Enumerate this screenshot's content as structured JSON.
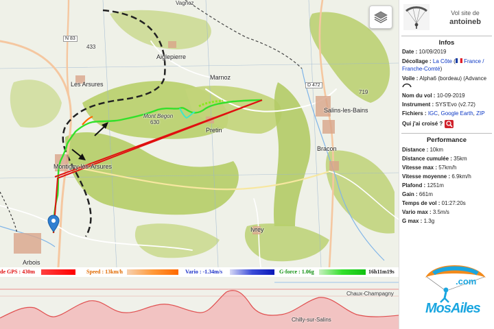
{
  "map": {
    "labels": {
      "aiglepierre": "Aiglepierre",
      "les_arsures": "Les Arsures",
      "marnoz": "Marnoz",
      "salins": "Salins-les-Bains",
      "mont_begon": "Mont Begon",
      "begon_alt": "630",
      "pretin": "Pretin",
      "bracon": "Bracon",
      "montigny": "Montigny-lès-Arsures",
      "ivrey": "Ivrey",
      "arbois": "Arbois",
      "chaux": "Chaux-Champagny",
      "chilly": "Chilly-sur-Salins",
      "n83": "N 83",
      "d472": "D 472",
      "spot_433": "433",
      "spot_719": "719",
      "vagnoz": "Vagnoz"
    },
    "layers_icon": "layers-icon",
    "pin_icon": "map-pin-icon"
  },
  "indicators": {
    "gps": "de GPS : 430m",
    "speed": "Speed : 13km/h",
    "vario": "Vario : -1.34m/s",
    "gforce": "G-force : 1.06g",
    "time": "16h11m19s"
  },
  "sidebar": {
    "vol_site_de": "Vol site de",
    "pilot": "antoineb",
    "infos_title": "Infos",
    "date_label": "Date :",
    "date_value": "10/09/2019",
    "decollage_label": "Décollage :",
    "decollage_site": "La Côte",
    "decollage_country": "France / Franche-Comté",
    "voile_label": "Voile :",
    "voile_value": "Alpha6 (bordeau) (Advance",
    "nom_label": "Nom du vol :",
    "nom_value": "10-09-2019",
    "instrument_label": "Instrument :",
    "instrument_value": "SYS'Evo (v2.72)",
    "fichiers_label": "Fichiers :",
    "fichier_igc": "IGC",
    "fichier_ge": "Google Earth",
    "fichier_zip": "ZIP",
    "croise_label": "Qui j'ai croisé ?",
    "perf_title": "Performance",
    "perf": [
      {
        "label": "Distance :",
        "value": "10km"
      },
      {
        "label": "Distance cumulée :",
        "value": "35km"
      },
      {
        "label": "Vitesse max :",
        "value": "57km/h"
      },
      {
        "label": "Vitesse moyenne :",
        "value": "6.9km/h"
      },
      {
        "label": "Plafond :",
        "value": "1251m"
      },
      {
        "label": "Gain :",
        "value": "661m"
      },
      {
        "label": "Temps de vol :",
        "value": "01:27:20s"
      },
      {
        "label": "Vario max :",
        "value": "3.5m/s"
      },
      {
        "label": "G max :",
        "value": "1.3g"
      }
    ]
  },
  "logo": {
    "com": ".com",
    "brand": "MosAiles"
  },
  "colors": {
    "track_green": "#32e02a",
    "route_red": "#e01010",
    "link_blue": "#0a36c4",
    "logo_orange": "#f28a1c",
    "logo_blue": "#1aa6e0"
  }
}
